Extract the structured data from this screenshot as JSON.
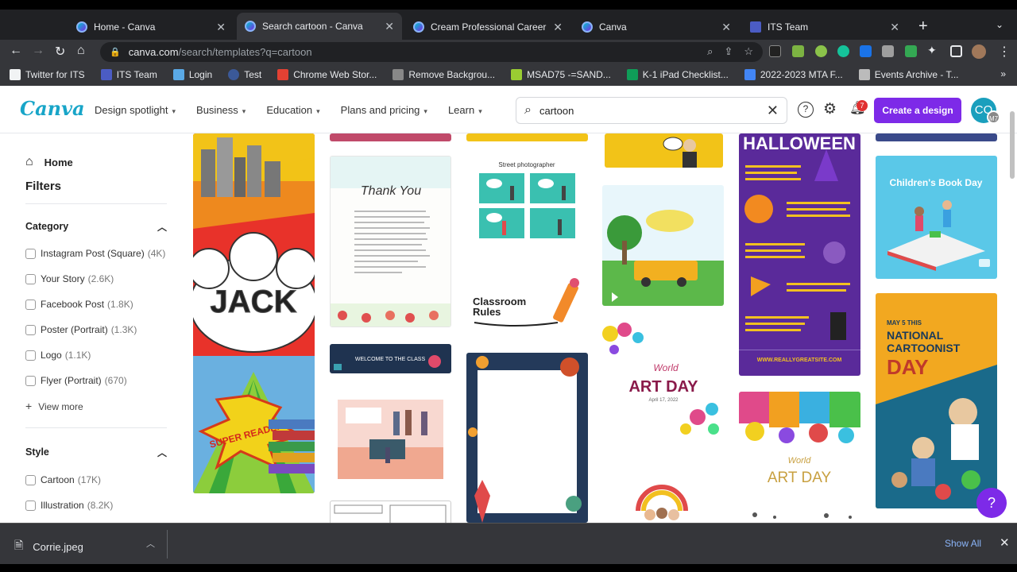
{
  "browser": {
    "tabs": [
      {
        "label": "Home - Canva",
        "icon": "canva-icon"
      },
      {
        "label": "Search cartoon - Canva",
        "icon": "canva-icon"
      },
      {
        "label": "Cream Professional Career Boo",
        "icon": "canva-icon"
      },
      {
        "label": "Canva",
        "icon": "canva-icon"
      },
      {
        "label": "ITS Team",
        "icon": "its-icon"
      }
    ],
    "new_tab": "+",
    "url_host": "canva.com",
    "url_path": "/search/templates?q=cartoon",
    "bookmarks": [
      {
        "label": "Twitter for ITS",
        "color": "#f1f3f4"
      },
      {
        "label": "ITS Team",
        "color": "#4b5cc4"
      },
      {
        "label": "Login",
        "color": "#5aa9e6"
      },
      {
        "label": "Test",
        "color": "#3b5998"
      },
      {
        "label": "Chrome Web Stor...",
        "color": "#e34133"
      },
      {
        "label": "Remove Backgrou...",
        "color": "#888888"
      },
      {
        "label": "MSAD75 -=SAND...",
        "color": "#9acd32"
      },
      {
        "label": "K-1 iPad Checklist...",
        "color": "#0f9d58"
      },
      {
        "label": "2022-2023 MTA F...",
        "color": "#4285f4"
      },
      {
        "label": "Events Archive - T...",
        "color": "#bbbbbb"
      }
    ]
  },
  "canva": {
    "logo": "Canva",
    "nav": [
      "Design spotlight",
      "Business",
      "Education",
      "Plans and pricing",
      "Learn"
    ],
    "search_value": "cartoon",
    "help_label": "?",
    "notifications_count": "7",
    "create_label": "Create a design",
    "avatar_initials": "CO",
    "avatar_sub": "M7",
    "floating_help": "?"
  },
  "sidebar": {
    "home": "Home",
    "filters": "Filters",
    "category_title": "Category",
    "categories": [
      {
        "label": "Instagram Post (Square)",
        "count": "(4K)"
      },
      {
        "label": "Your Story",
        "count": "(2.6K)"
      },
      {
        "label": "Facebook Post",
        "count": "(1.8K)"
      },
      {
        "label": "Poster (Portrait)",
        "count": "(1.3K)"
      },
      {
        "label": "Logo",
        "count": "(1.1K)"
      },
      {
        "label": "Flyer (Portrait)",
        "count": "(670)"
      }
    ],
    "view_more": "View more",
    "style_title": "Style",
    "styles": [
      {
        "label": "Cartoon",
        "count": "(17K)"
      },
      {
        "label": "Illustration",
        "count": "(8.2K)"
      }
    ]
  },
  "templates": {
    "jack": "JACK",
    "super_reader": "SUPER READER!",
    "thank_you": "Thank You",
    "street_photographer": "Street photographer",
    "welcome": "WELCOME TO THE CLASS",
    "classroom_rules": "Classroom Rules",
    "halloween": "HALLOWEEN",
    "halloween_url": "WWW.REALLYGREATSITE.COM",
    "childrens_book_day": "Children's Book Day",
    "art_day_1_small": "World",
    "art_day_1": "ART DAY",
    "art_day_1_date": "April 17, 2022",
    "art_day_2_small": "World",
    "art_day_2": "ART DAY",
    "cartoonist_day_date": "MAY 5 THIS",
    "cartoonist_day_line1": "NATIONAL",
    "cartoonist_day_line2": "CARTOONIST",
    "cartoonist_day_line3": "DAY"
  },
  "downloads": {
    "file": "Corrie.jpeg",
    "show_all": "Show All"
  }
}
